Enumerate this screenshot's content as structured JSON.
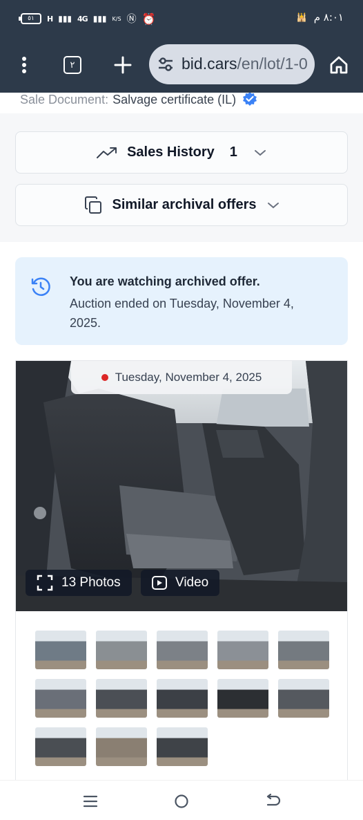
{
  "status_bar": {
    "time": "٨:٠١ م",
    "battery": "٥١",
    "signal_1": "H",
    "signal_2": "4G",
    "speed_unit": "K/S"
  },
  "browser": {
    "tab_count": "٢",
    "url_domain": "bid.cars",
    "url_path": "/en/lot/1-0"
  },
  "page": {
    "sale_document_label": "Sale Document:",
    "sale_document_value": "Salvage certificate (IL)",
    "sales_history_label": "Sales History",
    "sales_history_count": "1",
    "similar_offers_label": "Similar archival offers",
    "notice_title": "You are watching archived offer.",
    "notice_text": "Auction ended on Tuesday, November 4, 2025.",
    "photo_date": "Tuesday, November 4, 2025",
    "photos_button": "13 Photos",
    "video_button": "Video",
    "thumbnails": [
      {
        "name": "front-left exterior",
        "tone": "#6f7b86"
      },
      {
        "name": "side exterior",
        "tone": "#8a8f93"
      },
      {
        "name": "front exterior",
        "tone": "#7c8187"
      },
      {
        "name": "rear-side exterior",
        "tone": "#8b9096"
      },
      {
        "name": "rear exterior",
        "tone": "#747a80"
      },
      {
        "name": "damaged front",
        "tone": "#6a6f78"
      },
      {
        "name": "interior seats",
        "tone": "#4b4f55"
      },
      {
        "name": "dashboard",
        "tone": "#3c4046"
      },
      {
        "name": "instrument cluster",
        "tone": "#2c2f33"
      },
      {
        "name": "rear seats",
        "tone": "#55595f"
      },
      {
        "name": "engine bay",
        "tone": "#4a4e53"
      },
      {
        "name": "undercarriage",
        "tone": "#8a7f72"
      },
      {
        "name": "vin plate",
        "tone": "#3f4348"
      }
    ]
  },
  "colors": {
    "toolbar": "#2d3a4a",
    "notice_bg": "#e6f2fd",
    "accent_blue": "#3b82f6",
    "live_dot": "#dc2626"
  }
}
